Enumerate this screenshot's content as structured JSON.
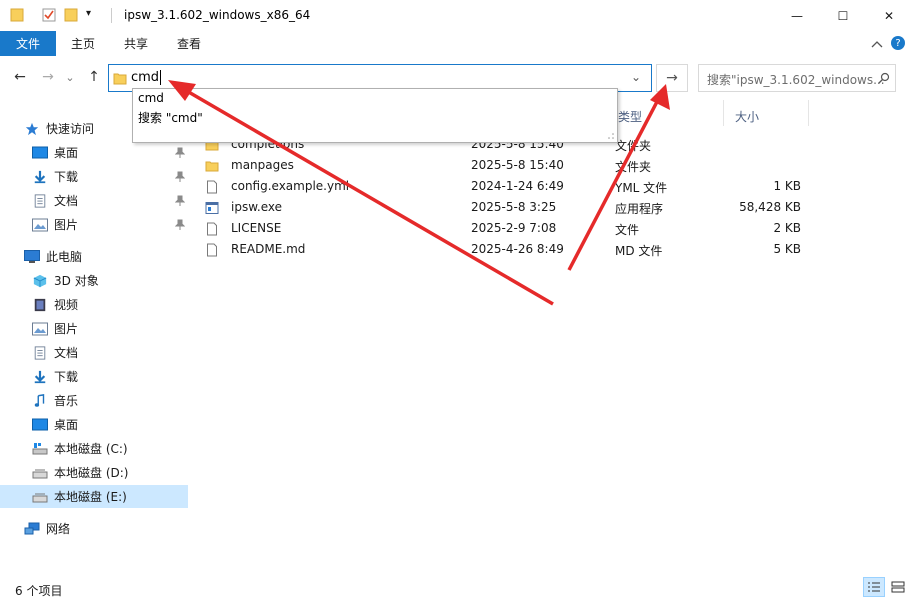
{
  "window": {
    "title": "ipsw_3.1.602_windows_x86_64",
    "dropdown_arrow": "▾",
    "minimize_icon": "—",
    "maximize_icon": "☐",
    "close_icon": "✕"
  },
  "ribbon": {
    "tabs": [
      "文件",
      "主页",
      "共享",
      "查看"
    ],
    "collapse_icon": "chevron-up",
    "help_icon": "?"
  },
  "nav": {
    "back": "←",
    "forward": "→",
    "recent": "⌄",
    "up": "↑",
    "address_value": "cmd",
    "address_dropdown": "⌄",
    "go": "→",
    "search_placeholder": "搜索\"ipsw_3.1.602_windows...",
    "search_icon": "⌕"
  },
  "autocomplete": {
    "items": [
      "cmd",
      "搜索 \"cmd\""
    ]
  },
  "sidebar": {
    "quick_access": "快速访问",
    "quick_items": [
      "桌面",
      "下载",
      "文档",
      "图片"
    ],
    "this_pc": "此电脑",
    "pc_items": [
      "3D 对象",
      "视频",
      "图片",
      "文档",
      "下载",
      "音乐",
      "桌面",
      "本地磁盘 (C:)",
      "本地磁盘 (D:)",
      "本地磁盘 (E:)"
    ],
    "network": "网络"
  },
  "columns": {
    "type": "类型",
    "size": "大小"
  },
  "files": [
    {
      "name": "completions",
      "date": "2025-5-8 15:40",
      "type": "文件夹",
      "size": "",
      "kind": "folder"
    },
    {
      "name": "manpages",
      "date": "2025-5-8 15:40",
      "type": "文件夹",
      "size": "",
      "kind": "folder"
    },
    {
      "name": "config.example.yml",
      "date": "2024-1-24 6:49",
      "type": "YML 文件",
      "size": "1 KB",
      "kind": "file"
    },
    {
      "name": "ipsw.exe",
      "date": "2025-5-8 3:25",
      "type": "应用程序",
      "size": "58,428 KB",
      "kind": "exe"
    },
    {
      "name": "LICENSE",
      "date": "2025-2-9 7:08",
      "type": "文件",
      "size": "2 KB",
      "kind": "file"
    },
    {
      "name": "README.md",
      "date": "2025-4-26 8:49",
      "type": "MD 文件",
      "size": "5 KB",
      "kind": "file"
    }
  ],
  "status": {
    "count": "6 个项目"
  },
  "colors": {
    "accent": "#1979ca",
    "arrow": "#e52a2a",
    "folder": "#f8cf5b",
    "selected": "#cce8ff"
  }
}
